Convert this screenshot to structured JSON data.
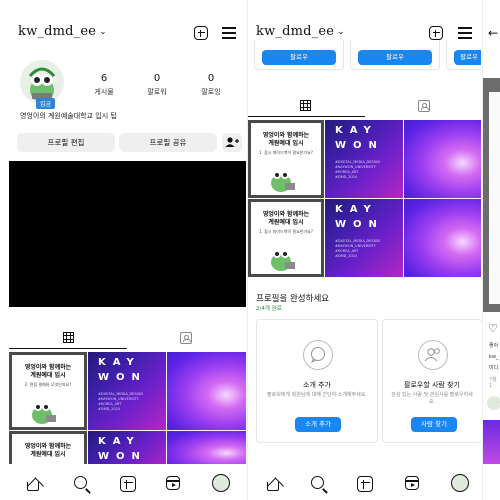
{
  "profile": {
    "username": "kw_dmd_ee",
    "badge": "입금",
    "stats": [
      {
        "value": "6",
        "label": "게시물"
      },
      {
        "value": "0",
        "label": "팔로워"
      },
      {
        "value": "0",
        "label": "팔로잉"
      }
    ],
    "bio": "영엉이의 계원예술대학교 입시 팁",
    "buttons": {
      "edit": "프로필 편집",
      "share": "프로필 공유"
    }
  },
  "posts": {
    "illus_title": "영엉이와 함께하는\n계원예대 입시",
    "illus_sub_1": "2. 면접 필패와 무엇인지요?",
    "illus_sub_2": "1. 참시 파이드백이 필요한가요?",
    "kay": "KAY",
    "won": "WON",
    "kay_small": "#DIGITAL_MEDIA_DESIGN\n#KAYWON_UNIVERSITY\n#KOREA_ART\n#DMD_2024"
  },
  "pane2": {
    "follow_label": "팔로우",
    "complete_title": "프로필을 완성하세요",
    "complete_progress": "2/4개 완료",
    "cards": [
      {
        "title": "소개 추가",
        "desc": "팔로워에게 회원님에 대해 간단히 소개해주세요.",
        "button": "소개 추가"
      },
      {
        "title": "팔로우할 사람 찾기",
        "desc": "관심 있는 사람 및 관심사를 팔로우하세요.",
        "button": "사람 찾기"
      }
    ]
  },
  "pane3": {
    "back": "←",
    "heart": "♡",
    "lines": [
      "좋아",
      "kw_",
      "미디",
      "7월 1"
    ]
  },
  "colors": {
    "accent": "#1a86f0",
    "progress_green": "#2a8a3a"
  },
  "icons": [
    "chevron-down-icon",
    "new-post-icon",
    "menu-icon",
    "grid-icon",
    "tagged-icon",
    "home-icon",
    "search-icon",
    "create-icon",
    "reels-icon",
    "discover-people-icon",
    "heart-icon",
    "back-arrow-icon"
  ]
}
